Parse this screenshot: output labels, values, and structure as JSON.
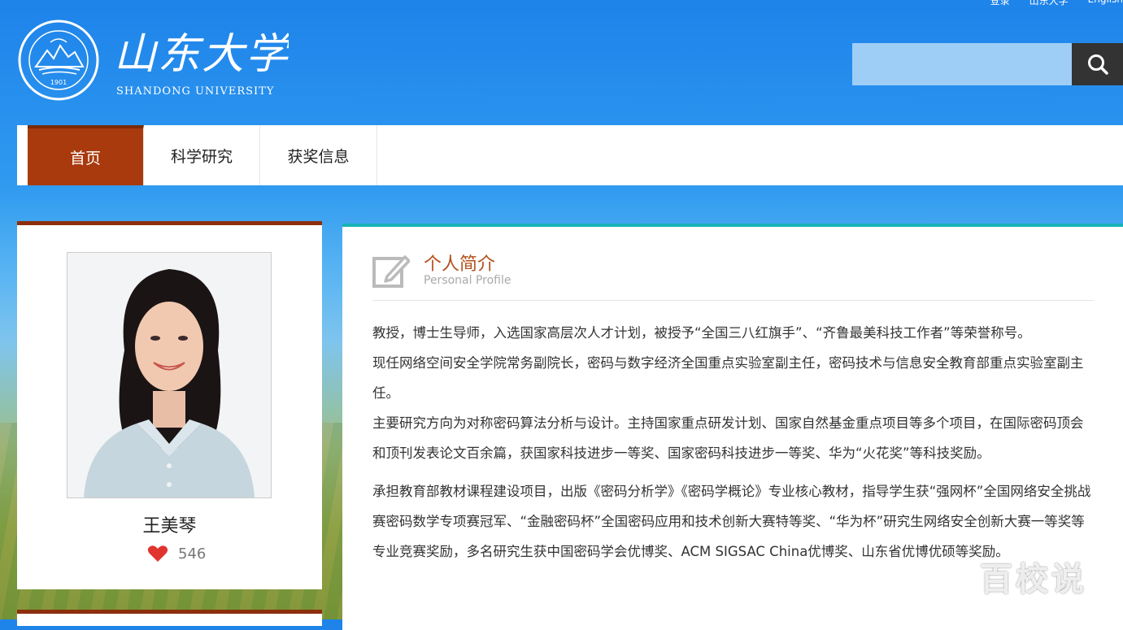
{
  "top_links": [
    "登录",
    "山东大学",
    "English"
  ],
  "logo": {
    "chinese": "山东大学",
    "english": "SHANDONG UNIVERSITY",
    "emblem_year": "1901",
    "emblem_ring": "SHANDONG UNIVERSITY"
  },
  "search": {
    "placeholder": "",
    "icon": "search-icon"
  },
  "nav": {
    "items": [
      {
        "label": "首页",
        "active": true
      },
      {
        "label": "科学研究",
        "active": false
      },
      {
        "label": "获奖信息",
        "active": false
      }
    ]
  },
  "profile": {
    "name": "王美琴",
    "likes": "546",
    "like_icon": "heart-icon"
  },
  "section": {
    "title": "个人简介",
    "subtitle": "Personal Profile",
    "icon": "edit-icon"
  },
  "bio": [
    "教授，博士生导师，入选国家高层次人才计划，被授予“全国三八红旗手”、“齐鲁最美科技工作者”等荣誉称号。",
    "现任网络空间安全学院常务副院长，密码与数字经济全国重点实验室副主任，密码技术与信息安全教育部重点实验室副主任。",
    "主要研究方向为对称密码算法分析与设计。主持国家重点研发计划、国家自然基金重点项目等多个项目，在国际密码顶会和顶刊发表论文百余篇，获国家科技进步一等奖、国家密码科技进步一等奖、华为“火花奖”等科技奖励。",
    "承担教育部教材课程建设项目，出版《密码分析学》《密码学概论》专业核心教材，指导学生获“强网杯”全国网络安全挑战赛密码数学专项赛冠军、“金融密码杯”全国密码应用和技术创新大赛特等奖、“华为杯”研究生网络安全创新大赛一等奖等专业竞赛奖励，多名研究生获中国密码学会优博奖、ACM SIGSAC China优博奖、山东省优博优硕等奖励。"
  ],
  "watermark": "百校说",
  "colors": {
    "nav_active": "#a83a0e",
    "card_border": "#8c2f0c",
    "main_border": "#17b3b6",
    "section_title": "#b3501b",
    "heart": "#e0342f"
  }
}
